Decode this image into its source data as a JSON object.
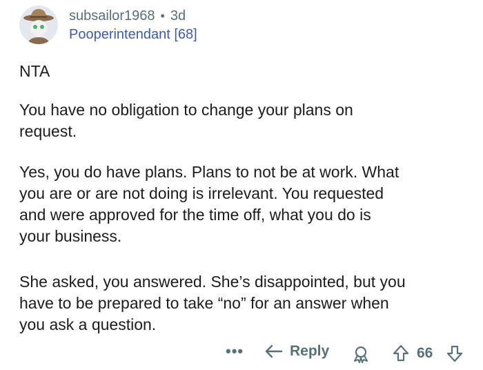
{
  "comment": {
    "username": "subsailor1968",
    "separator": "•",
    "age": "3d",
    "flair": "Pooperintendant [68]",
    "paragraphs": {
      "nta": "NTA",
      "p1": "You have no obligation to change your plans on\nrequest.",
      "p2": "Yes, you do have plans. Plans to not be at work. What\nyou are or are not doing is irrelevant. You requested\nand were approved for the time off, what you do is\nyour business.",
      "p3": "She asked, you answered. She’s disappointed, but you\nhave to be prepared to take “no” for an answer when\nyou ask a question."
    }
  },
  "actions": {
    "more_label": "•••",
    "reply_label": "Reply",
    "score": "66"
  },
  "icons": {
    "avatar": "avatar-icon",
    "more": "more-icon",
    "reply": "reply-arrow-icon",
    "award": "award-icon",
    "upvote": "upvote-arrow-icon",
    "downvote": "downvote-arrow-icon"
  },
  "colors": {
    "meta_gray": "#576f76",
    "flair_blue": "#3e5ba9",
    "text": "#1c1c1c",
    "background": "#ffffff"
  }
}
